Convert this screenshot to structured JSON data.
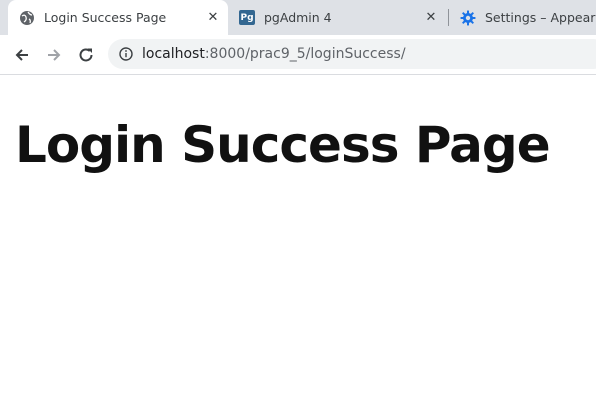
{
  "tabs": [
    {
      "title": "Login Success Page",
      "icon": "globe-icon",
      "active": true,
      "close": "✕"
    },
    {
      "title": "pgAdmin 4",
      "icon": "pgadmin-icon",
      "badge": "Pg",
      "active": false,
      "close": "✕"
    },
    {
      "title": "Settings – Appearance",
      "icon": "gear-icon",
      "active": false
    }
  ],
  "address_bar": {
    "host": "localhost",
    "path": ":8000/prac9_5/loginSuccess/"
  },
  "page": {
    "heading": "Login Success Page"
  },
  "colors": {
    "tabbar_bg": "#dee1e6",
    "omnibox_bg": "#f1f3f4",
    "settings_icon": "#1a73e8",
    "pgadmin_badge": "#336791"
  }
}
